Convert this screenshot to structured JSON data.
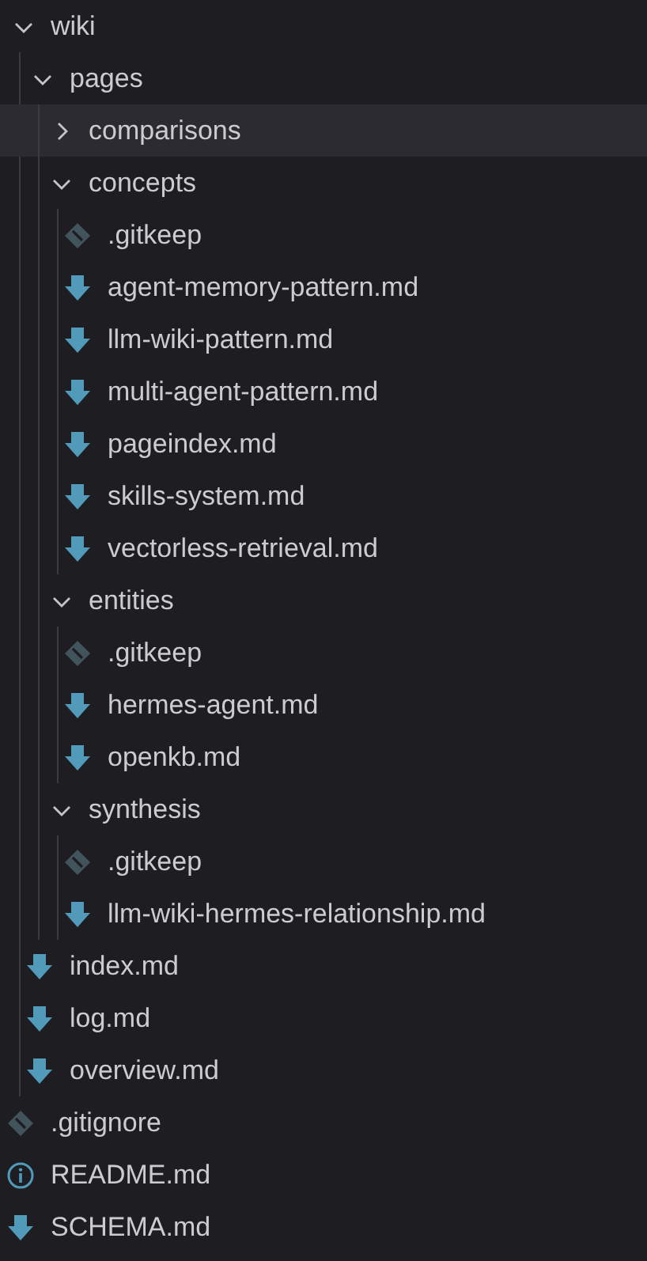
{
  "tree": [
    {
      "kind": "folder",
      "name": "wiki",
      "expanded": true,
      "highlighted": false,
      "children": [
        {
          "kind": "folder",
          "name": "pages",
          "expanded": true,
          "highlighted": false,
          "children": [
            {
              "kind": "folder",
              "name": "comparisons",
              "expanded": false,
              "highlighted": true
            },
            {
              "kind": "folder",
              "name": "concepts",
              "expanded": true,
              "highlighted": false,
              "children": [
                {
                  "kind": "git",
                  "name": ".gitkeep",
                  "highlighted": false
                },
                {
                  "kind": "markdown",
                  "name": "agent-memory-pattern.md",
                  "highlighted": false
                },
                {
                  "kind": "markdown",
                  "name": "llm-wiki-pattern.md",
                  "highlighted": false
                },
                {
                  "kind": "markdown",
                  "name": "multi-agent-pattern.md",
                  "highlighted": false
                },
                {
                  "kind": "markdown",
                  "name": "pageindex.md",
                  "highlighted": false
                },
                {
                  "kind": "markdown",
                  "name": "skills-system.md",
                  "highlighted": false
                },
                {
                  "kind": "markdown",
                  "name": "vectorless-retrieval.md",
                  "highlighted": false
                }
              ]
            },
            {
              "kind": "folder",
              "name": "entities",
              "expanded": true,
              "highlighted": false,
              "children": [
                {
                  "kind": "git",
                  "name": ".gitkeep",
                  "highlighted": false
                },
                {
                  "kind": "markdown",
                  "name": "hermes-agent.md",
                  "highlighted": false
                },
                {
                  "kind": "markdown",
                  "name": "openkb.md",
                  "highlighted": false
                }
              ]
            },
            {
              "kind": "folder",
              "name": "synthesis",
              "expanded": true,
              "highlighted": false,
              "children": [
                {
                  "kind": "git",
                  "name": ".gitkeep",
                  "highlighted": false
                },
                {
                  "kind": "markdown",
                  "name": "llm-wiki-hermes-relationship.md",
                  "highlighted": false
                }
              ]
            }
          ]
        },
        {
          "kind": "markdown",
          "name": "index.md",
          "highlighted": false
        },
        {
          "kind": "markdown",
          "name": "log.md",
          "highlighted": false
        },
        {
          "kind": "markdown",
          "name": "overview.md",
          "highlighted": false
        }
      ]
    },
    {
      "kind": "git",
      "name": ".gitignore",
      "highlighted": false
    },
    {
      "kind": "info",
      "name": "README.md",
      "highlighted": false
    },
    {
      "kind": "markdown",
      "name": "SCHEMA.md",
      "highlighted": false
    }
  ]
}
